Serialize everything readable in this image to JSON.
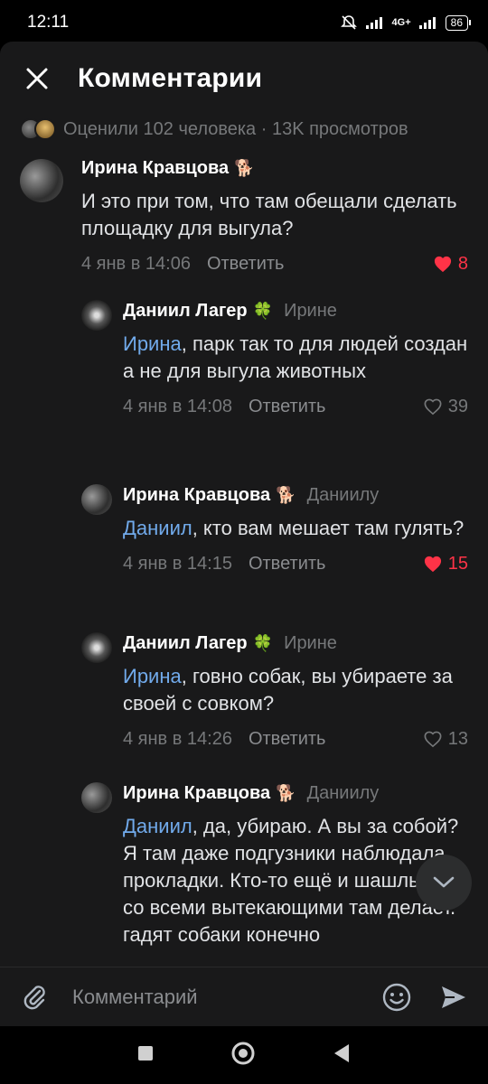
{
  "status": {
    "time": "12:11",
    "network": "4G+",
    "battery": "86"
  },
  "header": {
    "title": "Комментарии"
  },
  "stats": {
    "text": "Оценили 102 человека · 13K просмотров"
  },
  "comments": [
    {
      "author": "Ирина Кравцова",
      "badge": "🐕",
      "reply_to": "",
      "mention": "",
      "text": "И это при том, что там обещали сделать площадку для выгула?",
      "date": "4 янв в 14:06",
      "reply_label": "Ответить",
      "likes": "8",
      "liked": true
    },
    {
      "author": "Даниил Лагер",
      "badge": "🍀",
      "reply_to": "Ирине",
      "mention": "Ирина",
      "text": ", парк так то для людей создан а не для выгула животных",
      "date": "4 янв в 14:08",
      "reply_label": "Ответить",
      "likes": "39",
      "liked": false
    },
    {
      "author": "Ирина Кравцова",
      "badge": "🐕",
      "reply_to": "Даниилу",
      "mention": "Даниил",
      "text": ", кто вам мешает там гулять?",
      "date": "4 янв в 14:15",
      "reply_label": "Ответить",
      "likes": "15",
      "liked": true
    },
    {
      "author": "Даниил Лагер",
      "badge": "🍀",
      "reply_to": "Ирине",
      "mention": "Ирина",
      "text": ", говно собак, вы убираете за своей с совком?",
      "date": "4 янв в 14:26",
      "reply_label": "Ответить",
      "likes": "13",
      "liked": false
    },
    {
      "author": "Ирина Кравцова",
      "badge": "🐕",
      "reply_to": "Даниилу",
      "mention": "Даниил",
      "text": ", да, убираю. А вы за собой? Я там даже подгузники наблюдала, прокладки. Кто-то ещё и шашлыки со всеми вытекающими там делает. гадят собаки конечно",
      "date": "",
      "reply_label": "",
      "likes": "",
      "liked": false
    }
  ],
  "composer": {
    "placeholder": "Комментарий"
  },
  "colors": {
    "accent": "#71aaeb",
    "like": "#ff3347",
    "background": "#19191a"
  }
}
